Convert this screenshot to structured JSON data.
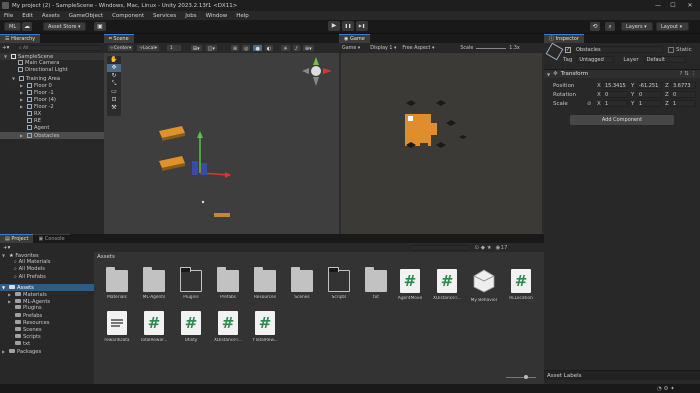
{
  "window": {
    "title": "My project (2) - SampleScene - Windows, Mac, Linux - Unity 2023.2.13f1 <DX11>",
    "controls": [
      "—",
      "☐",
      "✕"
    ]
  },
  "menu": [
    "File",
    "Edit",
    "Assets",
    "GameObject",
    "Component",
    "Services",
    "Jobs",
    "Window",
    "Help"
  ],
  "toolbar": {
    "account_initials": "ML",
    "asset_store": "Asset Store ▾",
    "play": "▶",
    "pause": "❚❚",
    "step": "▶❚",
    "layers": "Layers",
    "layout": "Layout"
  },
  "hierarchy": {
    "tab": "Hierarchy",
    "search_placeholder": "All",
    "scene": "SampleScene",
    "items": [
      "Main Camera",
      "Directional Light",
      "Training Area",
      "Floor 0",
      "Floor -1",
      "Floor (4)",
      "Floor -2",
      "RX",
      "RE",
      "Agent",
      "Obstacles"
    ]
  },
  "scene_view": {
    "tab": "Scene",
    "pivot": "Center",
    "space": "Local",
    "grid_value": "1"
  },
  "game_view": {
    "tab": "Game",
    "mode": "Game",
    "display": "Display 1",
    "aspect": "Free Aspect",
    "scale_label": "Scale",
    "scale_value": "1.3x"
  },
  "inspector": {
    "tab": "Inspector",
    "object_name": "Obstacles",
    "static_label": "Static",
    "tag_label": "Tag",
    "tag_value": "Untagged",
    "layer_label": "Layer",
    "layer_value": "Default",
    "component": "Transform",
    "position_label": "Position",
    "rotation_label": "Rotation",
    "scale_label": "Scale",
    "position": {
      "x": "15.3415",
      "y": "-61.251",
      "z": "3.6773"
    },
    "rotation": {
      "x": "0",
      "y": "0",
      "z": "0"
    },
    "scale": {
      "x": "1",
      "y": "1",
      "z": "1"
    },
    "add_component": "Add Component",
    "asset_labels": "Asset Labels"
  },
  "project": {
    "tab": "Project",
    "console_tab": "Console",
    "favorites_label": "Favorites",
    "favorites": [
      "All Materials",
      "All Models",
      "All Prefabs"
    ],
    "assets_label": "Assets",
    "folders": [
      "Materials",
      "ML-Agents",
      "Plugins",
      "Prefabs",
      "Resources",
      "Scenes",
      "Scripts",
      "txt"
    ],
    "packages_label": "Packages",
    "breadcrumb": "Assets",
    "count": "17",
    "items_row1": [
      "Materials",
      "ML-Agents",
      "Plugins",
      "Prefabs",
      "Resources",
      "Scenes",
      "Scripts",
      "txt",
      "AgentMove",
      "XDistanceT...",
      "My Behavior",
      "RLLocation"
    ],
    "items_row2": [
      "rewardData",
      "TotalRewar...",
      "Utility",
      "XDistanceT...",
      "YTotalRew..."
    ]
  }
}
